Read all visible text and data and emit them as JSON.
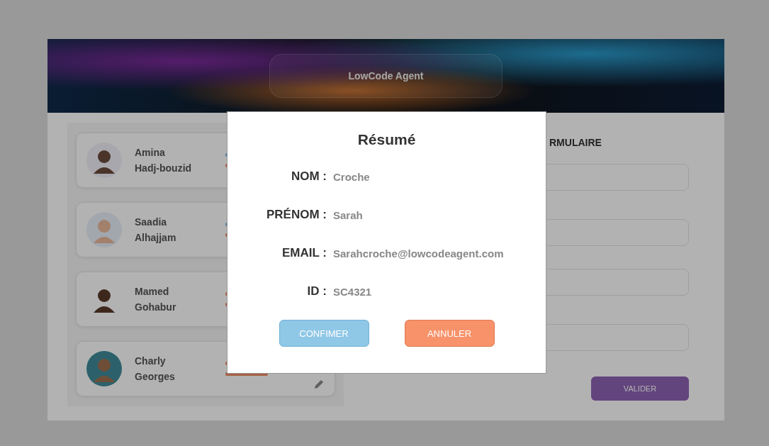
{
  "header": {
    "title": "LowCode Agent"
  },
  "contacts": [
    {
      "first_name": "Amina",
      "last_name": "Hadj-bouzid"
    },
    {
      "first_name": "Saadia",
      "last_name": "Alhajjam"
    },
    {
      "first_name": "Mamed",
      "last_name": "Gohabur"
    },
    {
      "first_name": "Charly",
      "last_name": "Georges"
    }
  ],
  "form": {
    "heading": "RMULAIRE",
    "submit": "VALIDER"
  },
  "dialog": {
    "title": "Résumé",
    "rows": [
      {
        "label": "NOM :",
        "value": "Croche"
      },
      {
        "label": "PRÉNOM :",
        "value": "Sarah"
      },
      {
        "label": "EMAIL :",
        "value": "Sarahcroche@lowcodeagent.com"
      },
      {
        "label": "ID :",
        "value": "SC4321"
      }
    ],
    "buttons": [
      {
        "label": "CONFIMER",
        "kind": "confirm"
      },
      {
        "label": "ANNULER",
        "kind": "cancel"
      }
    ]
  }
}
